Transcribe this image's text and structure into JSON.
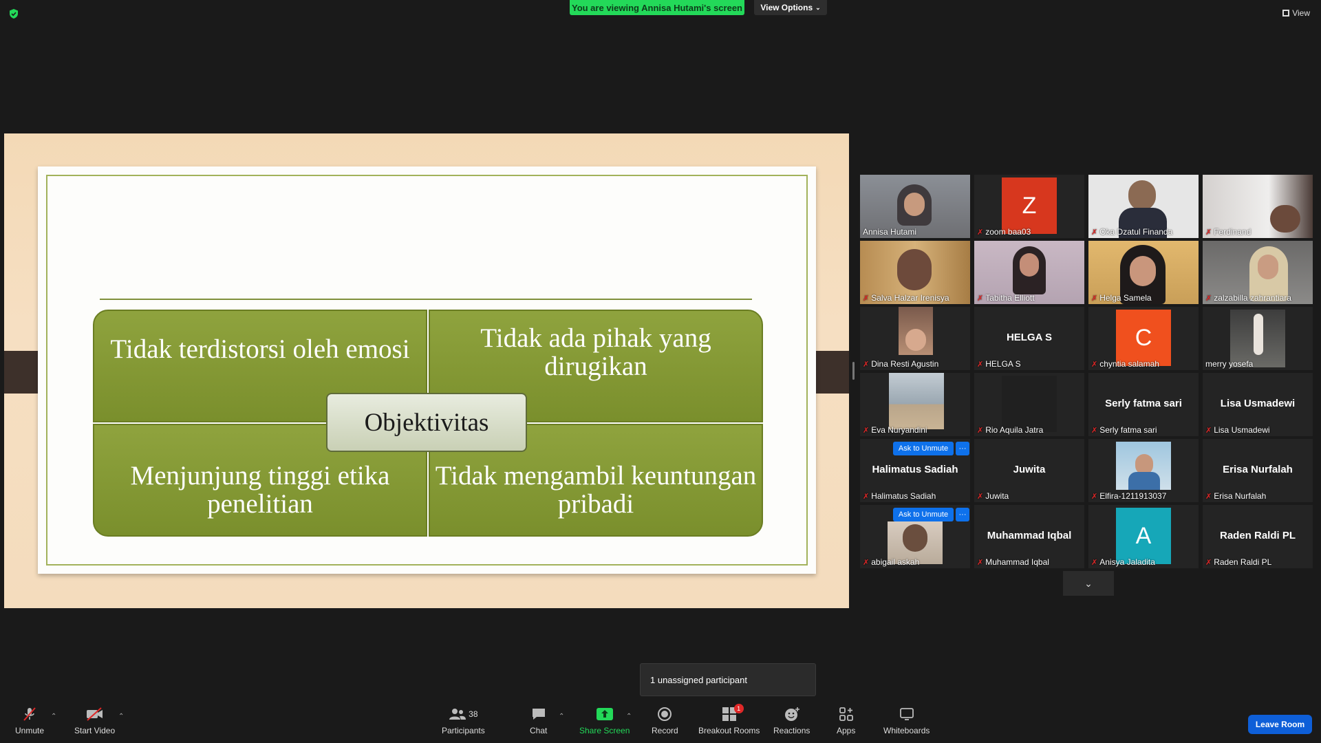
{
  "top": {
    "viewing_banner": "You are viewing Annisa Hutami's screen",
    "view_options": "View Options",
    "view_label": "View"
  },
  "slide": {
    "center": "Objektivitas",
    "top_left": "Tidak terdistorsi oleh emosi",
    "top_right": "Tidak ada pihak yang dirugikan",
    "bottom_left": "Menjunjung tinggi etika penelitian",
    "bottom_right": "Tidak mengambil keuntungan pribadi"
  },
  "gallery": {
    "ask_unmute_label": "Ask to Unmute",
    "more_label": "···",
    "tiles": [
      {
        "name": "Annisa Hutami",
        "big": "",
        "letter": "",
        "active": true,
        "muted": false
      },
      {
        "name": "zoom baa03",
        "big": "",
        "letter": "Z",
        "muted": true
      },
      {
        "name": "Oka Dzatul Finanda",
        "big": "",
        "letter": "",
        "muted": true
      },
      {
        "name": "Ferdinand",
        "big": "",
        "letter": "",
        "muted": true
      },
      {
        "name": "Salva Halzar Irenisya",
        "big": "",
        "letter": "",
        "muted": true
      },
      {
        "name": "Tabitha Elliott",
        "big": "",
        "letter": "",
        "muted": true
      },
      {
        "name": "Helga Samela",
        "big": "",
        "letter": "",
        "muted": true
      },
      {
        "name": "zalzabilla zahrantiara",
        "big": "",
        "letter": "",
        "muted": true
      },
      {
        "name": "Dina Resti Agustin",
        "big": "",
        "letter": "",
        "muted": true
      },
      {
        "name": "HELGA S",
        "big": "HELGA S",
        "letter": "",
        "muted": true
      },
      {
        "name": "chyntia salamah",
        "big": "",
        "letter": "C",
        "muted": true
      },
      {
        "name": "merry yosefa",
        "big": "",
        "letter": "",
        "muted": false
      },
      {
        "name": "Eva Nuryandini",
        "big": "",
        "letter": "",
        "muted": true
      },
      {
        "name": "Rio Aquila Jatra",
        "big": "",
        "letter": "",
        "muted": true
      },
      {
        "name": "Serly fatma sari",
        "big": "Serly fatma sari",
        "letter": "",
        "muted": true
      },
      {
        "name": "Lisa Usmadewi",
        "big": "Lisa Usmadewi",
        "letter": "",
        "muted": true
      },
      {
        "name": "Halimatus Sadiah",
        "big": "Halimatus Sadiah",
        "letter": "",
        "muted": true,
        "ask": true
      },
      {
        "name": "Juwita",
        "big": "Juwita",
        "letter": "",
        "muted": true
      },
      {
        "name": "Elfira-1211913037",
        "big": "",
        "letter": "",
        "muted": true
      },
      {
        "name": "Erisa Nurfalah",
        "big": "Erisa Nurfalah",
        "letter": "",
        "muted": true
      },
      {
        "name": "abigail askah",
        "big": "",
        "letter": "",
        "muted": true,
        "ask": true
      },
      {
        "name": "Muhammad Iqbal",
        "big": "Muhammad Iqbal",
        "letter": "",
        "muted": true
      },
      {
        "name": "Anisya Jaladita",
        "big": "",
        "letter": "A",
        "muted": true
      },
      {
        "name": "Raden Raldi PL",
        "big": "Raden Raldi PL",
        "letter": "",
        "muted": true
      }
    ]
  },
  "tooltip": "1 unassigned participant",
  "toolbar": {
    "unmute": "Unmute",
    "start_video": "Start Video",
    "participants": "Participants",
    "participants_count": "38",
    "chat": "Chat",
    "share_screen": "Share Screen",
    "record": "Record",
    "breakout_rooms": "Breakout Rooms",
    "breakout_badge": "1",
    "reactions": "Reactions",
    "apps": "Apps",
    "whiteboards": "Whiteboards",
    "leave": "Leave Room"
  },
  "colors": {
    "banner_green": "#23d959",
    "leave_blue": "#0e5fd8",
    "slide_olive": "#7a8f2c",
    "muted_red": "#e02828"
  }
}
